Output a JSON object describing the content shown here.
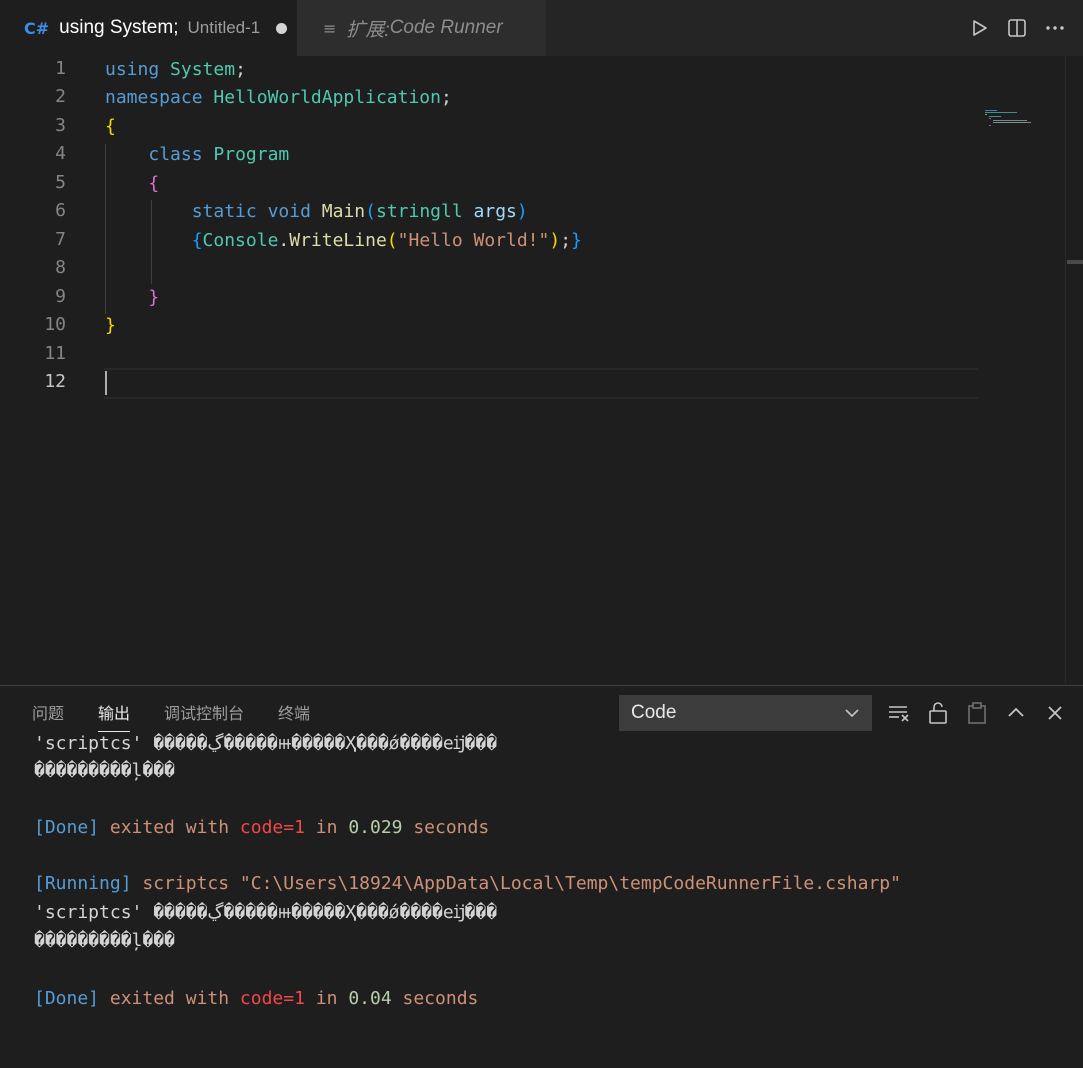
{
  "tabs": {
    "active": {
      "lang_icon": "C#",
      "title": "using System;",
      "subtitle": "Untitled-1"
    },
    "inactive": {
      "title_prefix": "扩展:",
      "title_rest": " Code Runner"
    }
  },
  "toolbar": {
    "run_icon": "run-icon",
    "split_icon": "split-editor-icon",
    "more_icon": "more-icon"
  },
  "editor": {
    "line_numbers": [
      "1",
      "2",
      "3",
      "4",
      "5",
      "6",
      "7",
      "8",
      "9",
      "10",
      "11",
      "12"
    ],
    "current_line": "12",
    "code": {
      "l1": [
        "using",
        " ",
        "System",
        ";"
      ],
      "l2": [
        "namespace",
        " ",
        "HelloWorldApplication",
        ";"
      ],
      "l3": [
        "{"
      ],
      "l4": [
        "    ",
        "class",
        " ",
        "Program"
      ],
      "l5": [
        "    ",
        "{"
      ],
      "l6": [
        "        ",
        "static",
        " ",
        "void",
        " ",
        "Main",
        "(",
        "stringll",
        " ",
        "args",
        ")"
      ],
      "l7": [
        "        ",
        "{",
        "Console",
        ".",
        "WriteLine",
        "(",
        "\"Hello World!\"",
        ")",
        ";",
        "}"
      ],
      "l9": [
        "    ",
        "}"
      ],
      "l10": [
        "}"
      ]
    }
  },
  "panel": {
    "tabs": [
      "问题",
      "输出",
      "调试控制台",
      "终端"
    ],
    "active_tab": "输出",
    "channel_select": "Code",
    "actions": [
      "clear-output-icon",
      "lock-scroll-icon",
      "open-log-icon",
      "maximize-panel-icon",
      "close-panel-icon"
    ],
    "output": {
      "line1_a": "'scriptcs' ",
      "line1_b": "�����ڲ�����ⲿ�����Ҳ���ǿ����еĳ���",
      "line2": "���������ļ���",
      "done1": {
        "tag": "[Done]",
        "exited": " exited with ",
        "code": "code=1",
        "in": " in ",
        "time": "0.029",
        "secs": " seconds"
      },
      "run": {
        "tag": "[Running]",
        "cmd": " scriptcs \"C:\\Users\\18924\\AppData\\Local\\Temp\\tempCodeRunnerFile.csharp\""
      },
      "line3_a": "'scriptcs' ",
      "line3_b": "�����ڲ�����ⲿ�����Ҳ���ǿ����еĳ���",
      "line4": "���������ļ���",
      "done2": {
        "tag": "[Done]",
        "exited": " exited with ",
        "code": "code=1",
        "in": " in ",
        "time": "0.04",
        "secs": " seconds"
      }
    }
  }
}
